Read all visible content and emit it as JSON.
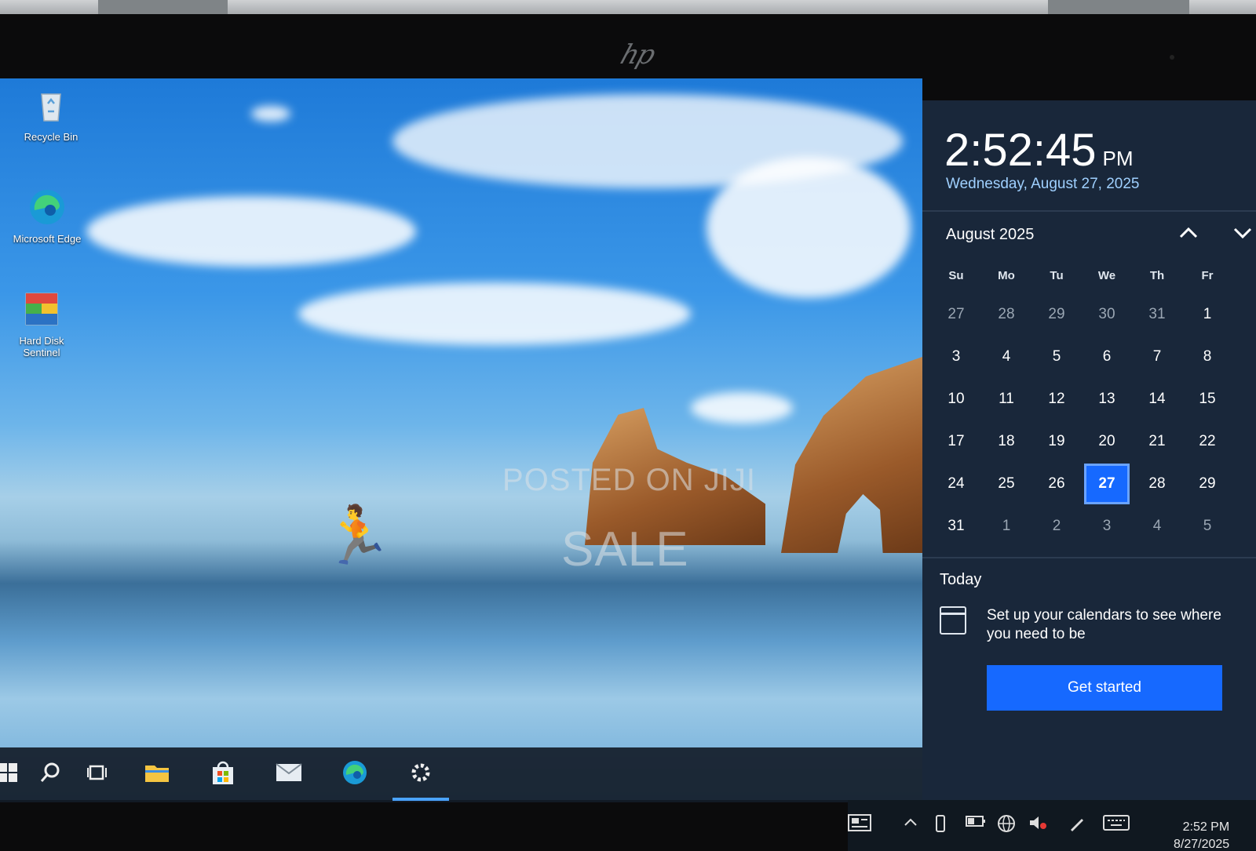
{
  "desktop": {
    "icons": [
      {
        "label": "Recycle Bin"
      },
      {
        "label": "Microsoft Edge"
      },
      {
        "label": "Hard Disk Sentinel"
      }
    ],
    "watermark_line1": "POSTED ON JIJI",
    "watermark_line2": "SALE"
  },
  "clock_flyout": {
    "time": "2:52:45",
    "ampm": "PM",
    "date": "Wednesday, August 27, 2025",
    "month_label": "August 2025",
    "weekdays": [
      "Su",
      "Mo",
      "Tu",
      "We",
      "Th",
      "Fr"
    ],
    "weeks": [
      [
        "27",
        "28",
        "29",
        "30",
        "31",
        "1"
      ],
      [
        "3",
        "4",
        "5",
        "6",
        "7",
        "8"
      ],
      [
        "10",
        "11",
        "12",
        "13",
        "14",
        "15"
      ],
      [
        "17",
        "18",
        "19",
        "20",
        "21",
        "22"
      ],
      [
        "24",
        "25",
        "26",
        "27",
        "28",
        "29"
      ],
      [
        "31",
        "1",
        "2",
        "3",
        "4",
        "5"
      ]
    ],
    "today_label": "Today",
    "agenda_text": "Set up your calendars to see where you need to be",
    "get_started_label": "Get started"
  },
  "taskbar": {
    "icons": [
      "windows-start-icon",
      "search-icon",
      "task-view-icon",
      "file-explorer-icon",
      "store-icon",
      "mail-icon",
      "edge-icon",
      "settings-icon"
    ],
    "active_icon": "settings-icon"
  },
  "tray": {
    "icons": [
      "news-icon",
      "show-hidden-icons-icon",
      "phone-icon",
      "battery-icon",
      "network-icon",
      "volume-icon",
      "pen-icon",
      "touch-keyboard-icon"
    ],
    "time": "2:52 PM",
    "date": "8/27/2025"
  },
  "colors": {
    "accent": "#1669ff",
    "flyout_bg": "#19273a",
    "date_text": "#9fd0ff"
  }
}
